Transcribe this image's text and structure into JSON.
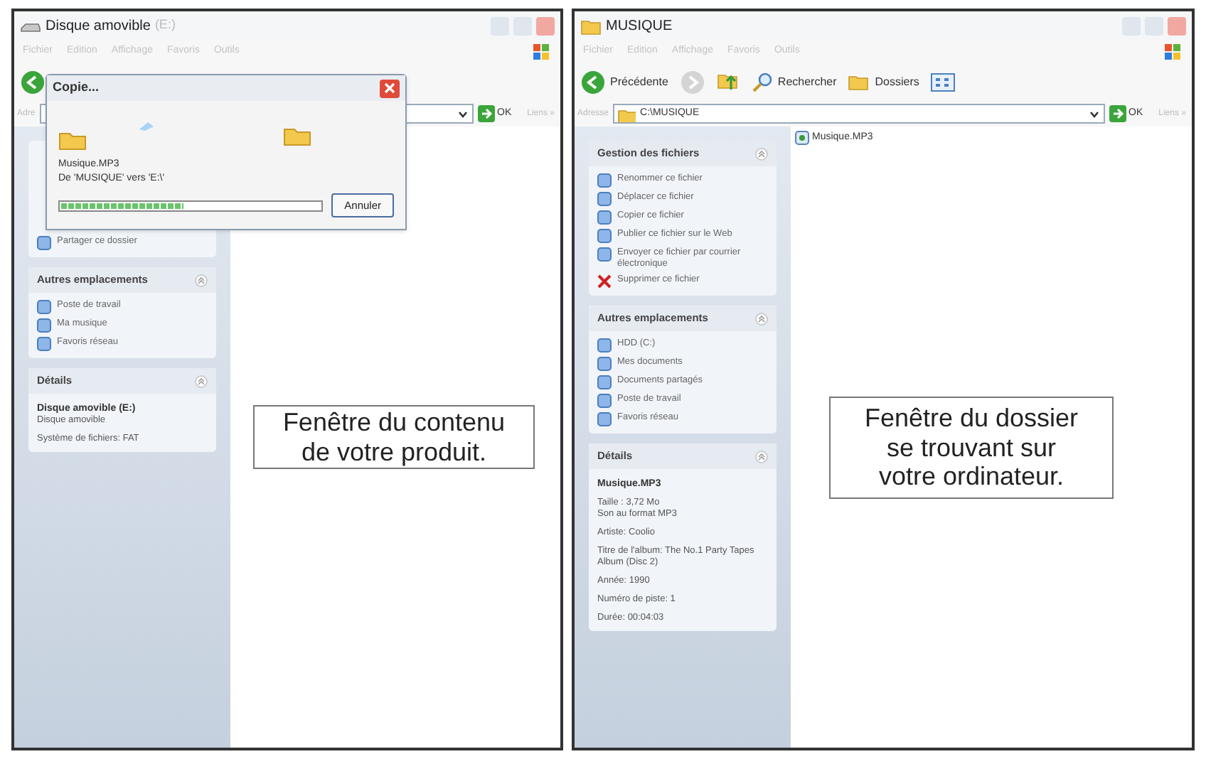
{
  "windows": [
    {
      "title": "Disque amovible",
      "title_suffix": "(E:)",
      "menu": [
        "Fichier",
        "Edition",
        "Affichage",
        "Favoris",
        "Outils"
      ],
      "toolbar": [
        {
          "kind": "back",
          "disabled": false
        }
      ],
      "address": {
        "label": "Adre",
        "go": "OK",
        "links": "Liens »"
      },
      "panels": [
        {
          "items": [
            {
              "kind": "task",
              "text": "Partager ce dossier"
            }
          ]
        },
        {
          "title": "Autres emplacements",
          "items": [
            {
              "kind": "task",
              "text": "Poste de travail"
            },
            {
              "kind": "task",
              "text": "Ma musique"
            },
            {
              "kind": "task",
              "text": "Favoris réseau"
            }
          ]
        },
        {
          "title": "Détails",
          "items": [
            {
              "kind": "name",
              "text": "Disque amovible (E:)"
            },
            {
              "kind": "line",
              "text": "Disque amovible"
            },
            {
              "kind": "gap",
              "text": "Système de fichiers: FAT"
            }
          ]
        }
      ],
      "callout": "Fenêtre du contenu de votre produit."
    },
    {
      "title": "MUSIQUE",
      "menu": [
        "Fichier",
        "Edition",
        "Affichage",
        "Favoris",
        "Outils"
      ],
      "toolbar": [
        {
          "kind": "back",
          "label": "Précédente",
          "disabled": false
        },
        {
          "kind": "forward",
          "disabled": true
        },
        {
          "kind": "up"
        },
        {
          "kind": "search",
          "label": "Rechercher"
        },
        {
          "kind": "folders",
          "label": "Dossiers"
        },
        {
          "kind": "views"
        }
      ],
      "address": {
        "label": "Adresse",
        "value": "C:\\MUSIQUE",
        "go": "OK",
        "links": "Liens »"
      },
      "panels": [
        {
          "title": "Gestion des fichiers",
          "items": [
            {
              "kind": "task",
              "text": "Renommer ce fichier"
            },
            {
              "kind": "task",
              "text": "Déplacer ce fichier"
            },
            {
              "kind": "task",
              "text": "Copier ce fichier"
            },
            {
              "kind": "task",
              "text": "Publier ce fichier sur le Web"
            },
            {
              "kind": "task",
              "text": "Envoyer ce fichier par courrier électronique"
            },
            {
              "kind": "delete",
              "text": "Supprimer ce fichier"
            }
          ]
        },
        {
          "title": "Autres emplacements",
          "items": [
            {
              "kind": "task",
              "text": "HDD (C:)"
            },
            {
              "kind": "task",
              "text": "Mes documents"
            },
            {
              "kind": "task",
              "text": "Documents partagés"
            },
            {
              "kind": "task",
              "text": "Poste de travail"
            },
            {
              "kind": "task",
              "text": "Favoris réseau"
            }
          ]
        },
        {
          "title": "Détails",
          "items": [
            {
              "kind": "name",
              "text": "Musique.MP3"
            },
            {
              "kind": "gap",
              "text": "Taille : 3,72 Mo"
            },
            {
              "kind": "line",
              "text": "Son au format MP3"
            },
            {
              "kind": "gap",
              "text": "Artiste: Coolio"
            },
            {
              "kind": "gap",
              "text": "Titre de l'album: The No.1 Party Tapes Album (Disc 2)"
            },
            {
              "kind": "gap",
              "text": "Année: 1990"
            },
            {
              "kind": "gap",
              "text": "Numéro de piste: 1"
            },
            {
              "kind": "gap",
              "text": "Durée: 00:04:03"
            }
          ]
        }
      ],
      "files": [
        "Musique.MP3"
      ],
      "callout": "Fenêtre du dossier se trouvant sur votre ordinateur."
    }
  ],
  "dialog": {
    "title": "Copie...",
    "file": "Musique.MP3",
    "route": "De 'MUSIQUE' vers 'E:\\'",
    "progress": {
      "level": 0.47
    },
    "cancel": "Annuler"
  }
}
